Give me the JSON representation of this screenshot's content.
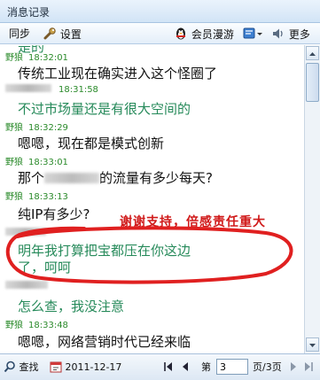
{
  "window": {
    "title": "消息记录"
  },
  "toolbar": {
    "sync_label": "同步",
    "settings_label": "设置",
    "roaming_label": "会员漫游",
    "more_label": "更多"
  },
  "messages": [
    {
      "sender": "野狼",
      "time": "18:32:01",
      "text": "传统工业现在确实进入这个怪圈了",
      "style": "black"
    },
    {
      "sender": "",
      "time": "18:31:58",
      "text": "不过市场量还是有很大空间的",
      "style": "green"
    },
    {
      "sender": "野狼",
      "time": "18:32:29",
      "text": "嗯嗯，现在都是模式创新",
      "style": "black"
    },
    {
      "sender": "野狼",
      "time": "18:33:01",
      "text_before": "那个",
      "text_after": "的流量有多少每天?",
      "style": "black"
    },
    {
      "sender": "野狼",
      "time": "18:33:13",
      "text": "纯IP有多少?",
      "style": "black"
    },
    {
      "sender": "",
      "time": "",
      "text_line1": "明年我打算把宝都压在你这边",
      "text_line2": "了，呵呵",
      "style": "green"
    },
    {
      "sender": "",
      "time": "",
      "text": "怎么查，我没注意",
      "style": "green"
    },
    {
      "sender": "野狼",
      "time": "18:33:48",
      "text": "嗯嗯，网络营销时代已经来临",
      "style": "black"
    }
  ],
  "annotation": {
    "note": "谢谢支持，倍感责任重大"
  },
  "statusbar": {
    "search_label": "查找",
    "date": "2011-12-17",
    "page_prefix": "第",
    "page_value": "3",
    "page_suffix": "页/3页"
  },
  "colors": {
    "sender": "#2a8a2a",
    "green_text": "#268a5a",
    "annotation": "#d01a1a"
  }
}
